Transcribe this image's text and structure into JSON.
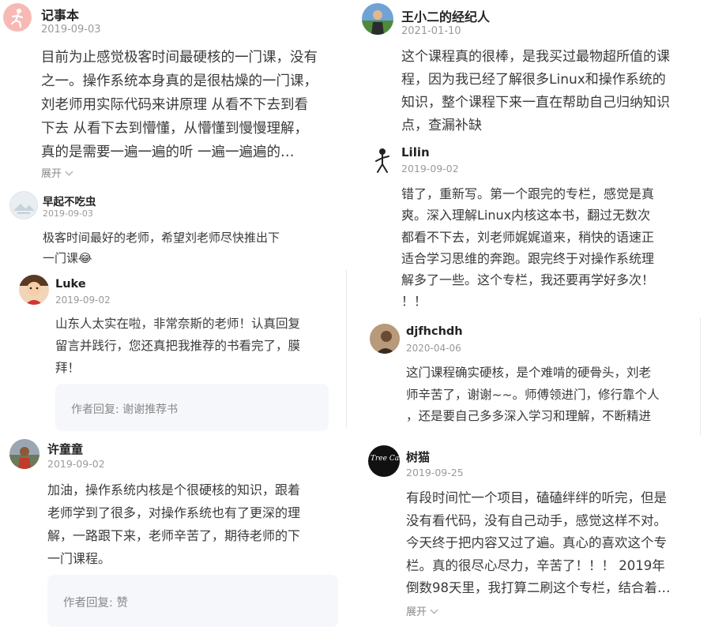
{
  "comments": {
    "c1": {
      "name": "记事本",
      "date": "2019-09-03",
      "lines": [
        "目前为止感觉极客时间最硬核的一门课，没有",
        "之一。操作系统本身真的是很枯燥的一门课，",
        "刘老师用实际代码来讲原理 从看不下去到看",
        "下去 从看下去到懵懂，从懵懂到慢慢理解，",
        "真的是需要一遍一遍的听 一遍一遍遍的…"
      ],
      "expand": "展开"
    },
    "c2": {
      "name": "早起不吃虫",
      "date": "2019-09-03",
      "lines": [
        "极客时间最好的老师，希望刘老师尽快推出下",
        "一门课😂"
      ]
    },
    "c3": {
      "name": "Luke",
      "date": "2019-09-02",
      "lines": [
        "山东人太实在啦，非常奈斯的老师！认真回复",
        "留言并践行，您还真把我推荐的书看完了，膜",
        "拜！"
      ],
      "reply": "作者回复: 谢谢推荐书"
    },
    "c4": {
      "name": "许童童",
      "date": "2019-09-02",
      "lines": [
        "加油，操作系统内核是个很硬核的知识，跟着",
        "老师学到了很多，对操作系统也有了更深的理",
        "解，一路跟下来，老师辛苦了，期待老师的下",
        "一门课程。"
      ],
      "reply": "作者回复: 赞"
    },
    "c5": {
      "name": "王小二的经纪人",
      "date": "2021-01-10",
      "lines": [
        "这个课程真的很棒，是我买过最物超所值的课",
        "程，因为我已经了解很多Linux和操作系统的",
        "知识，整个课程下来一直在帮助自己归纳知识",
        "点，查漏补缺"
      ]
    },
    "c6": {
      "name": "Lilin",
      "date": "2019-09-02",
      "lines": [
        "错了，重新写。第一个跟完的专栏，感觉是真",
        "爽。深入理解Linux内核这本书，翻过无数次",
        "都看不下去，刘老师娓娓道来，稍快的语速正",
        "适合学习思维的奔跑。跟完终于对操作系统理",
        "解多了一些。这个专栏，我还要再学好多次！",
        "！！"
      ]
    },
    "c7": {
      "name": "djfhchdh",
      "date": "2020-04-06",
      "lines": [
        "这门课程确实硬核，是个难啃的硬骨头，刘老",
        "师辛苦了，谢谢~~。师傅领进门，修行靠个人",
        "，还是要自己多多深入学习和理解，不断精进"
      ]
    },
    "c8": {
      "name": "树猫",
      "date": "2019-09-25",
      "avatar_text": "Tree Cat",
      "lines": [
        "有段时间忙一个项目，磕磕绊绊的听完，但是",
        "没有看代码，没有自己动手，感觉这样不对。",
        "今天终于把内容又过了遍。真心的喜欢这个专",
        "栏。真的很尽心尽力，辛苦了！！！ 2019年",
        "倒数98天里，我打算二刷这个专栏，结合着…"
      ],
      "expand": "展开"
    }
  },
  "colors": {
    "text": "#3a3a3a",
    "date": "#9a9a9a",
    "reply_bg": "#f6f7fb"
  }
}
